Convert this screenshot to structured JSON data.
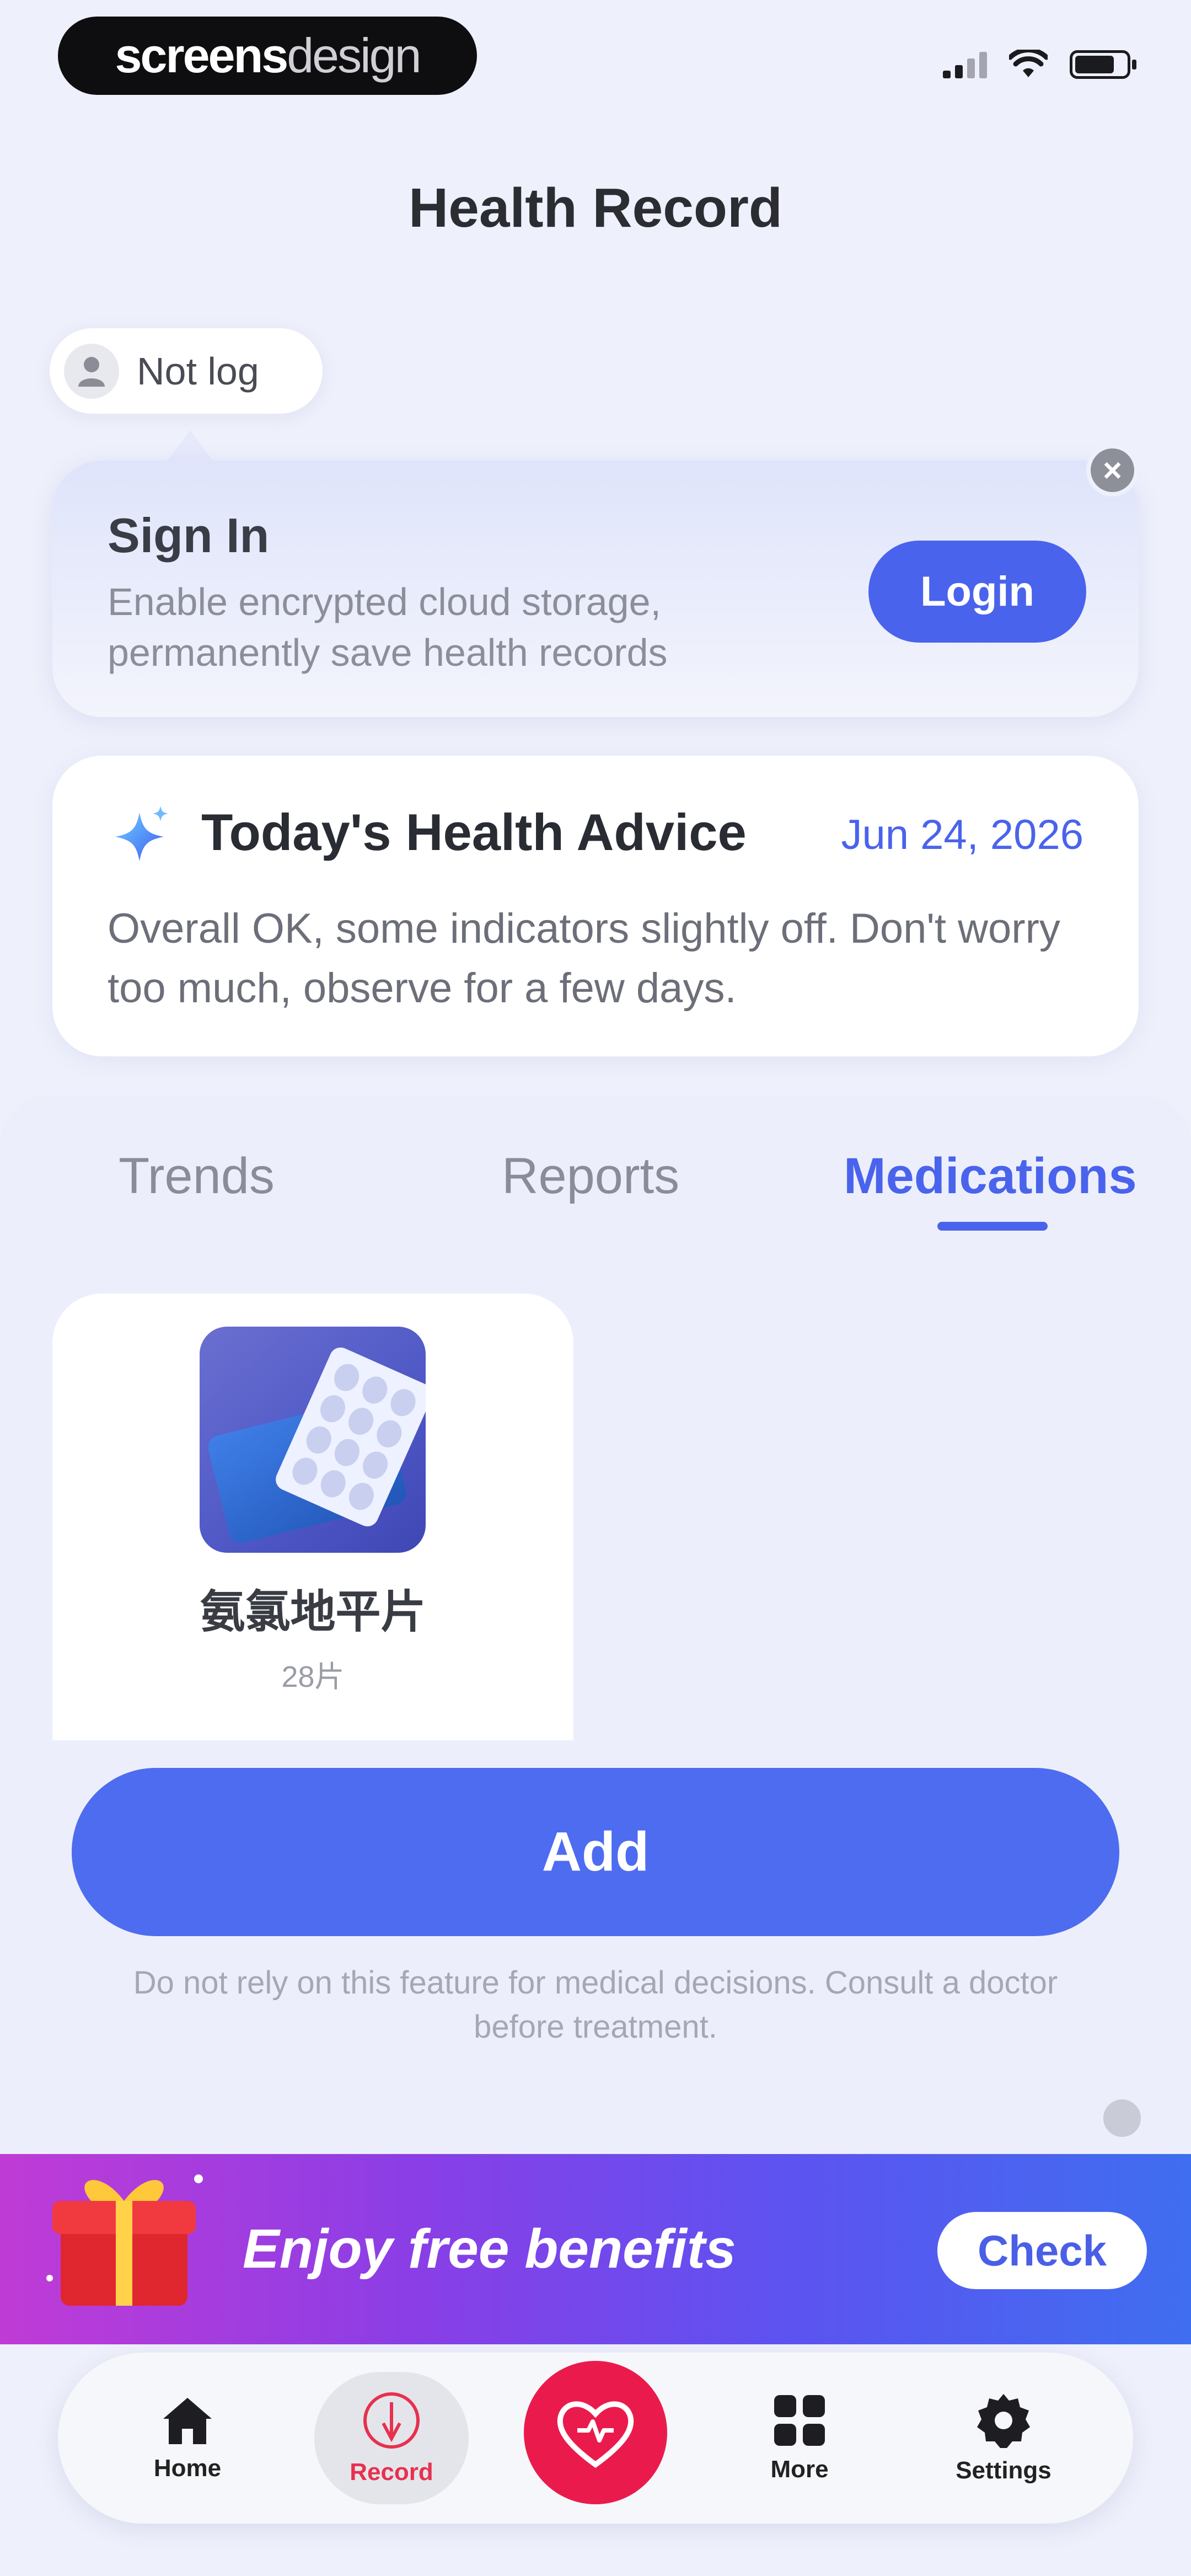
{
  "status_bar": {
    "brand_bold": "screens",
    "brand_light": "design"
  },
  "header": {
    "title": "Health Record"
  },
  "account": {
    "label": "Not log"
  },
  "signin_card": {
    "title": "Sign In",
    "description": "Enable encrypted cloud storage, permanently save health records",
    "login_label": "Login"
  },
  "advice": {
    "title": "Today's Health Advice",
    "date": "Jun 24, 2026",
    "text": "Overall OK, some indicators slightly off. Don't worry too much, observe for a few days."
  },
  "tabs": [
    {
      "label": "Trends"
    },
    {
      "label": "Reports"
    },
    {
      "label": "Medications",
      "active": true
    }
  ],
  "medication": {
    "name": "氨氯地平片",
    "quantity": "28片"
  },
  "add_label": "Add",
  "disclaimer": "Do not rely on this feature for medical decisions. Consult a doctor before treatment.",
  "banner": {
    "text": "Enjoy free benefits",
    "check_label": "Check"
  },
  "nav": [
    {
      "label": "Home",
      "icon": "home-icon"
    },
    {
      "label": "Record",
      "icon": "record-icon",
      "active": true
    },
    {
      "label": "",
      "icon": "heart-icon"
    },
    {
      "label": "More",
      "icon": "grid-icon"
    },
    {
      "label": "Settings",
      "icon": "gear-icon"
    }
  ],
  "colors": {
    "accent": "#4a63ec",
    "heart_button": "#ea1b4c",
    "background": "#eef0fb"
  }
}
